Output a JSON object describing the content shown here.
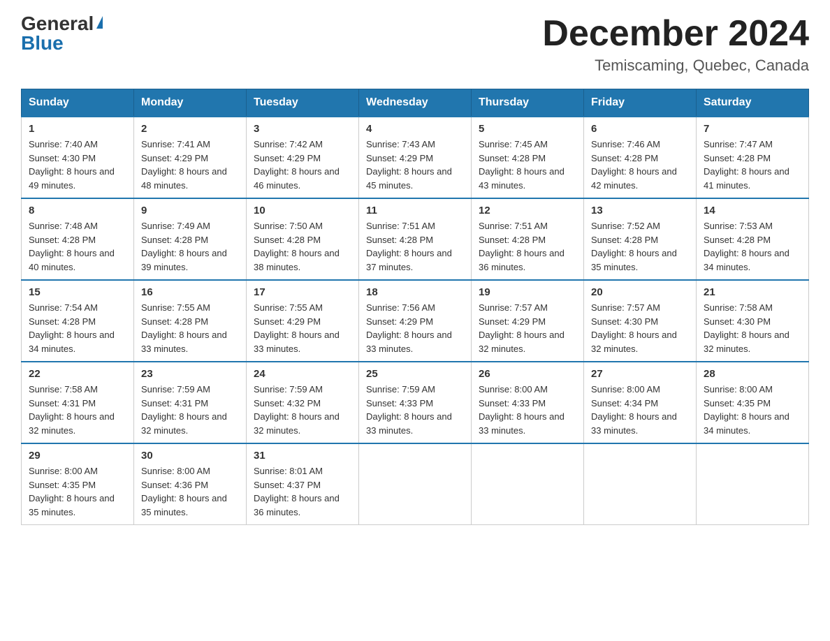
{
  "header": {
    "logo_general": "General",
    "logo_blue": "Blue",
    "month_title": "December 2024",
    "location": "Temiscaming, Quebec, Canada"
  },
  "weekdays": [
    "Sunday",
    "Monday",
    "Tuesday",
    "Wednesday",
    "Thursday",
    "Friday",
    "Saturday"
  ],
  "weeks": [
    [
      {
        "day": "1",
        "sunrise": "7:40 AM",
        "sunset": "4:30 PM",
        "daylight": "8 hours and 49 minutes."
      },
      {
        "day": "2",
        "sunrise": "7:41 AM",
        "sunset": "4:29 PM",
        "daylight": "8 hours and 48 minutes."
      },
      {
        "day": "3",
        "sunrise": "7:42 AM",
        "sunset": "4:29 PM",
        "daylight": "8 hours and 46 minutes."
      },
      {
        "day": "4",
        "sunrise": "7:43 AM",
        "sunset": "4:29 PM",
        "daylight": "8 hours and 45 minutes."
      },
      {
        "day": "5",
        "sunrise": "7:45 AM",
        "sunset": "4:28 PM",
        "daylight": "8 hours and 43 minutes."
      },
      {
        "day": "6",
        "sunrise": "7:46 AM",
        "sunset": "4:28 PM",
        "daylight": "8 hours and 42 minutes."
      },
      {
        "day": "7",
        "sunrise": "7:47 AM",
        "sunset": "4:28 PM",
        "daylight": "8 hours and 41 minutes."
      }
    ],
    [
      {
        "day": "8",
        "sunrise": "7:48 AM",
        "sunset": "4:28 PM",
        "daylight": "8 hours and 40 minutes."
      },
      {
        "day": "9",
        "sunrise": "7:49 AM",
        "sunset": "4:28 PM",
        "daylight": "8 hours and 39 minutes."
      },
      {
        "day": "10",
        "sunrise": "7:50 AM",
        "sunset": "4:28 PM",
        "daylight": "8 hours and 38 minutes."
      },
      {
        "day": "11",
        "sunrise": "7:51 AM",
        "sunset": "4:28 PM",
        "daylight": "8 hours and 37 minutes."
      },
      {
        "day": "12",
        "sunrise": "7:51 AM",
        "sunset": "4:28 PM",
        "daylight": "8 hours and 36 minutes."
      },
      {
        "day": "13",
        "sunrise": "7:52 AM",
        "sunset": "4:28 PM",
        "daylight": "8 hours and 35 minutes."
      },
      {
        "day": "14",
        "sunrise": "7:53 AM",
        "sunset": "4:28 PM",
        "daylight": "8 hours and 34 minutes."
      }
    ],
    [
      {
        "day": "15",
        "sunrise": "7:54 AM",
        "sunset": "4:28 PM",
        "daylight": "8 hours and 34 minutes."
      },
      {
        "day": "16",
        "sunrise": "7:55 AM",
        "sunset": "4:28 PM",
        "daylight": "8 hours and 33 minutes."
      },
      {
        "day": "17",
        "sunrise": "7:55 AM",
        "sunset": "4:29 PM",
        "daylight": "8 hours and 33 minutes."
      },
      {
        "day": "18",
        "sunrise": "7:56 AM",
        "sunset": "4:29 PM",
        "daylight": "8 hours and 33 minutes."
      },
      {
        "day": "19",
        "sunrise": "7:57 AM",
        "sunset": "4:29 PM",
        "daylight": "8 hours and 32 minutes."
      },
      {
        "day": "20",
        "sunrise": "7:57 AM",
        "sunset": "4:30 PM",
        "daylight": "8 hours and 32 minutes."
      },
      {
        "day": "21",
        "sunrise": "7:58 AM",
        "sunset": "4:30 PM",
        "daylight": "8 hours and 32 minutes."
      }
    ],
    [
      {
        "day": "22",
        "sunrise": "7:58 AM",
        "sunset": "4:31 PM",
        "daylight": "8 hours and 32 minutes."
      },
      {
        "day": "23",
        "sunrise": "7:59 AM",
        "sunset": "4:31 PM",
        "daylight": "8 hours and 32 minutes."
      },
      {
        "day": "24",
        "sunrise": "7:59 AM",
        "sunset": "4:32 PM",
        "daylight": "8 hours and 32 minutes."
      },
      {
        "day": "25",
        "sunrise": "7:59 AM",
        "sunset": "4:33 PM",
        "daylight": "8 hours and 33 minutes."
      },
      {
        "day": "26",
        "sunrise": "8:00 AM",
        "sunset": "4:33 PM",
        "daylight": "8 hours and 33 minutes."
      },
      {
        "day": "27",
        "sunrise": "8:00 AM",
        "sunset": "4:34 PM",
        "daylight": "8 hours and 33 minutes."
      },
      {
        "day": "28",
        "sunrise": "8:00 AM",
        "sunset": "4:35 PM",
        "daylight": "8 hours and 34 minutes."
      }
    ],
    [
      {
        "day": "29",
        "sunrise": "8:00 AM",
        "sunset": "4:35 PM",
        "daylight": "8 hours and 35 minutes."
      },
      {
        "day": "30",
        "sunrise": "8:00 AM",
        "sunset": "4:36 PM",
        "daylight": "8 hours and 35 minutes."
      },
      {
        "day": "31",
        "sunrise": "8:01 AM",
        "sunset": "4:37 PM",
        "daylight": "8 hours and 36 minutes."
      },
      null,
      null,
      null,
      null
    ]
  ]
}
